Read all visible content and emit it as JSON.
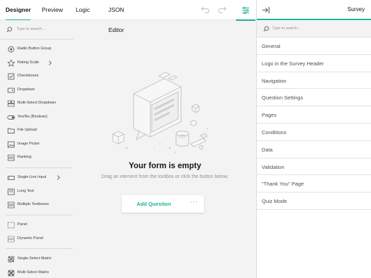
{
  "topbar": {
    "tabs": [
      {
        "label": "Designer",
        "active": true
      },
      {
        "label": "Preview",
        "active": false
      },
      {
        "label": "Logic",
        "active": false
      },
      {
        "label": "JSON Editor",
        "active": false
      }
    ],
    "undo_icon": "undo-icon",
    "redo_icon": "redo-icon",
    "settings_icon": "settings-sliders-icon"
  },
  "toolbox": {
    "search_placeholder": "Type to search...",
    "groups": [
      {
        "items": [
          {
            "label": "Radio Button Group",
            "icon": "radio-icon"
          },
          {
            "label": "Rating Scale",
            "icon": "star-icon",
            "has_submenu": true
          },
          {
            "label": "Checkboxes",
            "icon": "checkbox-icon"
          },
          {
            "label": "Dropdown",
            "icon": "dropdown-icon"
          },
          {
            "label": "Multi-Select Dropdown",
            "icon": "multi-dropdown-icon"
          },
          {
            "label": "Yes/No (Boolean)",
            "icon": "toggle-icon"
          },
          {
            "label": "File Upload",
            "icon": "folder-icon"
          },
          {
            "label": "Image Picker",
            "icon": "image-icon"
          },
          {
            "label": "Ranking",
            "icon": "ranking-icon"
          }
        ]
      },
      {
        "items": [
          {
            "label": "Single-Line Input",
            "icon": "text-input-icon",
            "has_submenu": true
          },
          {
            "label": "Long Text",
            "icon": "long-text-icon"
          },
          {
            "label": "Multiple Textboxes",
            "icon": "multiple-text-icon"
          }
        ]
      },
      {
        "items": [
          {
            "label": "Panel",
            "icon": "panel-icon"
          },
          {
            "label": "Dynamic Panel",
            "icon": "dynamic-panel-icon"
          }
        ]
      },
      {
        "items": [
          {
            "label": "Single-Select Matrix",
            "icon": "matrix-icon"
          },
          {
            "label": "Multi-Select Matrix",
            "icon": "multi-matrix-icon"
          }
        ]
      }
    ]
  },
  "canvas": {
    "empty_title": "Your form is empty",
    "empty_description": "Drag an element from the toolbox or click the button below.",
    "add_question_label": "Add Question",
    "more_label": "···"
  },
  "property_grid": {
    "title": "Survey",
    "search_placeholder": "Type to search...",
    "categories": [
      "General",
      "Logo in the Survey Header",
      "Navigation",
      "Question Settings",
      "Pages",
      "Conditions",
      "Data",
      "Validation",
      "\"Thank You\" Page",
      "Quiz Mode"
    ]
  },
  "colors": {
    "accent": "#19b394",
    "background": "#f3f3f3",
    "text": "#161616",
    "muted": "#909090"
  }
}
